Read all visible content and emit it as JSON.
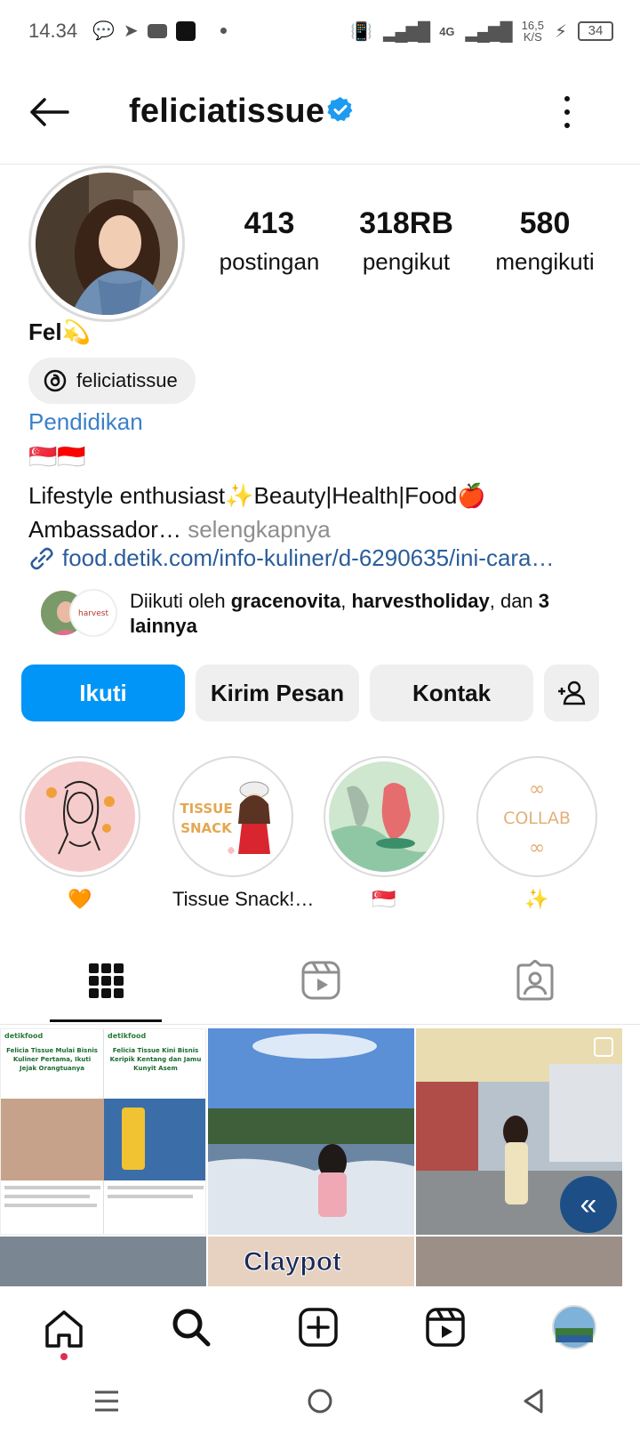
{
  "status_bar": {
    "time": "14.34",
    "speed": "16,5",
    "speed_unit": "K/S",
    "battery": "34",
    "network": "4G"
  },
  "header": {
    "username": "feliciatissue"
  },
  "stats": [
    {
      "value": "413",
      "label": "postingan"
    },
    {
      "value": "318RB",
      "label": "pengikut"
    },
    {
      "value": "580",
      "label": "mengikuti"
    }
  ],
  "bio": {
    "name": "Fel💫",
    "threads_handle": "feliciatissue",
    "category": "Pendidikan",
    "flags": "🇸🇬🇮🇩",
    "line1": "Lifestyle enthusiast✨Beauty|Health|Food🍎",
    "line2": "Ambassador…",
    "more": " selengkapnya",
    "link": "food.detik.com/info-kuliner/d-6290635/ini-cara…"
  },
  "followed_by": {
    "prefix": "Diikuti oleh ",
    "user1": "gracenovita",
    "sep": ", ",
    "user2": "harvestholiday",
    "suffix": ", dan ",
    "others": "3 lainnya"
  },
  "buttons": {
    "follow": "Ikuti",
    "message": "Kirim Pesan",
    "contact": "Kontak"
  },
  "highlights": [
    {
      "label": "🧡"
    },
    {
      "label": "Tissue Snack!…",
      "art_text1": "TISSUE",
      "art_text2": "SNACK"
    },
    {
      "label": "🇸🇬"
    },
    {
      "label": "✨",
      "art_text": "COLLAB"
    }
  ],
  "grid": {
    "post1_brand": "detikfood",
    "post1_headline_a": "Felicia Tissue Mulai Bisnis Kuliner Pertama, Ikuti Jejak Orangtuanya",
    "post1_headline_b": "Felicia Tissue Kini Bisnis Keripik Kentang dan Jamu Kunyit Asem",
    "post4_text": "Claypot"
  },
  "colors": {
    "primary": "#0095f6",
    "link": "#2b5d9a",
    "category": "#3a80c9",
    "verified": "#1d9bf0"
  }
}
